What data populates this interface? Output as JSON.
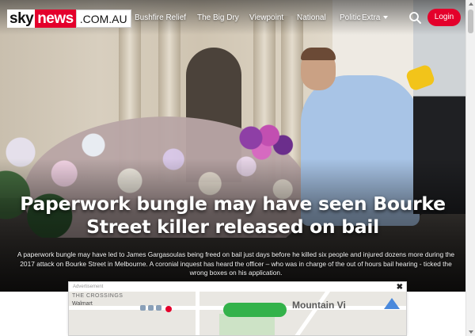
{
  "brand": {
    "logo_sky": "sky",
    "logo_news": "news",
    "logo_domain": ".COM.AU",
    "colors": {
      "red": "#e4002b",
      "white": "#ffffff"
    }
  },
  "nav": {
    "items": [
      "Bushfire Relief",
      "The Big Dry",
      "Viewpoint",
      "National",
      "Politic"
    ],
    "extra_label": "Extra",
    "search_icon": "search-icon",
    "login_label": "Login"
  },
  "article": {
    "headline": "Paperwork bungle may have seen Bourke Street killer released on bail",
    "summary": "A paperwork bungle may have led to James Gargasoulas being freed on bail just days before he killed six people and injured dozens more during the 2017 attack on Bourke Street in Melbourne. A coronial inquest has heard the officer – who was in charge of the out of hours bail hearing - ticked the wrong boxes on his application."
  },
  "ad": {
    "label": "Advertisement",
    "close": "✖",
    "map_text_top": "THE CROSSINGS",
    "map_text_walmart": "Walmart",
    "map_text_poi": "Mountain Vi"
  }
}
